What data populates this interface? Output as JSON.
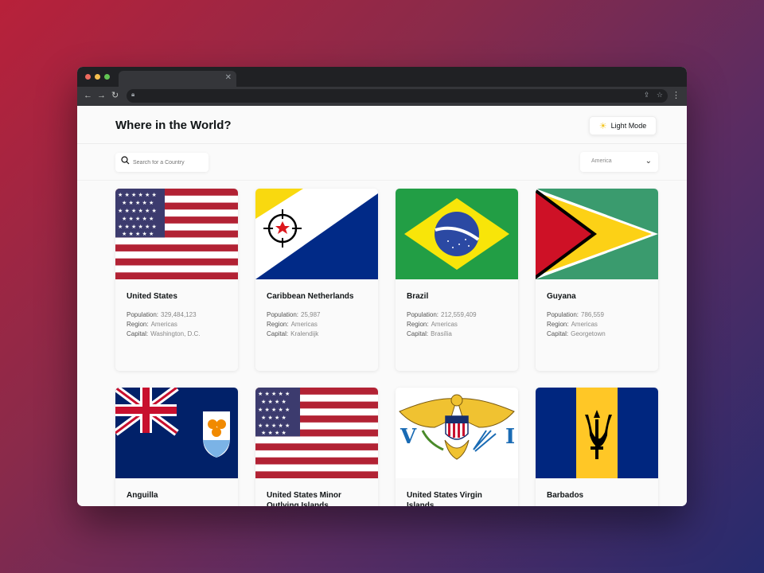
{
  "header": {
    "title": "Where in the World?",
    "mode_label": "Light Mode"
  },
  "search": {
    "placeholder": "Search for a Country"
  },
  "filter": {
    "selected": "America"
  },
  "labels": {
    "population": "Population:",
    "region": "Region:",
    "capital": "Capital:"
  },
  "cards": [
    {
      "name": "United States",
      "population": "329,484,123",
      "region": "Americas",
      "capital": "Washington, D.C."
    },
    {
      "name": "Caribbean Netherlands",
      "population": "25,987",
      "region": "Americas",
      "capital": "Kralendijk"
    },
    {
      "name": "Brazil",
      "population": "212,559,409",
      "region": "Americas",
      "capital": "Brasília"
    },
    {
      "name": "Guyana",
      "population": "786,559",
      "region": "Americas",
      "capital": "Georgetown"
    },
    {
      "name": "Anguilla"
    },
    {
      "name": "United States Minor Outlying Islands"
    },
    {
      "name": "United States Virgin Islands"
    },
    {
      "name": "Barbados"
    }
  ]
}
